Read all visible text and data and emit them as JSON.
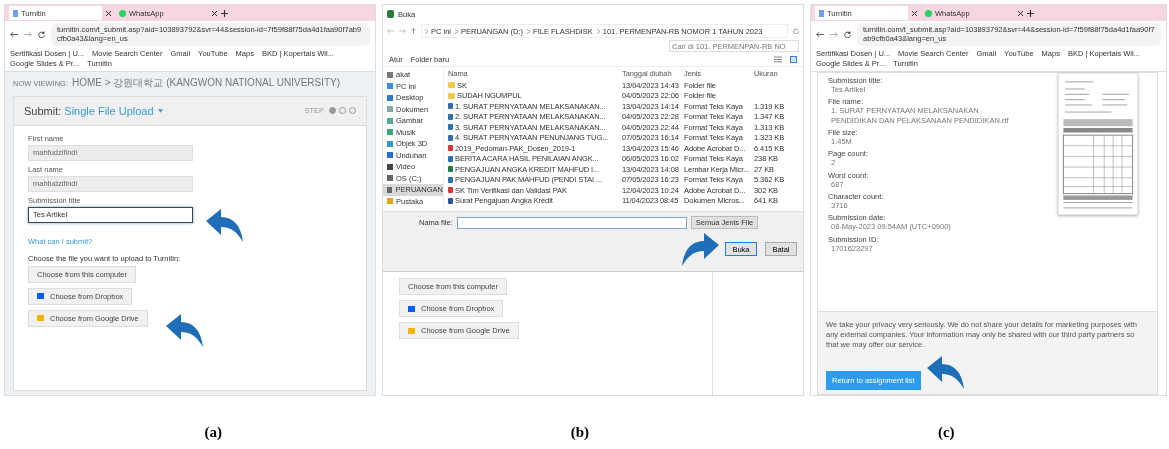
{
  "panel_a": {
    "browser": {
      "tabs": [
        {
          "label": "Turnitin",
          "selected": true
        },
        {
          "label": "WhatsApp",
          "selected": false
        }
      ],
      "url": "turnitin.com/t_submit.asp?aid=103893792&svr=44&session-id=7f59f88f75da4d1faa90f7ab9cfb0a43&lang=en_us",
      "bookmarks": [
        "Sertifikasi Dosen | U...",
        "Movie Search Center",
        "Gmail",
        "YouTube",
        "Maps",
        "BKD | Kopertais Wil...",
        "Google Slides & Pr...",
        "Turnitin"
      ]
    },
    "now_viewing_label": "NOW VIEWING:",
    "breadcrumb": "HOME > 강원대학교 (KANGWON NATIONAL UNIVERSITY)",
    "submit_label": "Submit:",
    "upload_mode": "Single File Upload",
    "step_label": "STEP",
    "steps": [
      {
        "selected": true
      },
      {
        "selected": false
      },
      {
        "selected": false
      }
    ],
    "fields": [
      {
        "label": "First name",
        "value": "mahfudzifindi",
        "disabled": true
      },
      {
        "label": "Last name",
        "value": "mahfudzifindi",
        "disabled": true
      },
      {
        "label": "Submission title",
        "value": "Tes Artikel",
        "disabled": false
      }
    ],
    "help_link": "What can I submit?",
    "choose_prompt": "Choose the file you want to upload to Turnitin:",
    "upload_buttons": [
      {
        "kind": "computer",
        "label": "Choose from this computer"
      },
      {
        "kind": "dropbox",
        "label": "Choose from Dropbox"
      },
      {
        "kind": "drive",
        "label": "Choose from Google Drive"
      }
    ]
  },
  "panel_b": {
    "title": "Buka",
    "path": [
      "PC ini",
      "PERUANGAN (D:)",
      "FILE FLASHDISK",
      "101. PERMENPAN-RB NOMOR 1 TAHUN 2023"
    ],
    "search_placeholder": "Cari di 101. PERMENPAN-RB NO",
    "toolbar": [
      "Atur",
      "Folder baru"
    ],
    "sidebar": [
      {
        "kind": "user",
        "label": "akat",
        "selected": false
      },
      {
        "kind": "pc",
        "label": "PC ini",
        "selected": false
      },
      {
        "kind": "desktop",
        "label": "Desktop",
        "selected": false
      },
      {
        "kind": "docs",
        "label": "Dokumen",
        "selected": false
      },
      {
        "kind": "pictures",
        "label": "Gambar",
        "selected": false
      },
      {
        "kind": "music",
        "label": "Musik",
        "selected": false
      },
      {
        "kind": "objects",
        "label": "Objek 3D",
        "selected": false
      },
      {
        "kind": "download",
        "label": "Unduhan",
        "selected": false
      },
      {
        "kind": "video",
        "label": "Video",
        "selected": false
      },
      {
        "kind": "drive",
        "label": "OS (C:)",
        "selected": false
      },
      {
        "kind": "drive",
        "label": "PERUANGAN",
        "selected": true
      },
      {
        "kind": "library",
        "label": "Pustaka",
        "selected": false
      }
    ],
    "columns": [
      "Nama",
      "Tanggal diubah",
      "Jenis",
      "Ukuran"
    ],
    "files": [
      {
        "kind": "folder",
        "name": "SK",
        "date": "13/04/2023 14:43",
        "type": "Folder file"
      },
      {
        "kind": "folder",
        "name": "SUDAH NGUMPUL",
        "date": "04/05/2023 22:06",
        "type": "Folder file"
      },
      {
        "kind": "rtf",
        "name": "1. SURAT PERNYATAAN MELAKSANAKAN...",
        "date": "13/04/2023 14:14",
        "type": "Format Teks Kaya",
        "size": "1.319 KB"
      },
      {
        "kind": "rtf",
        "name": "2. SURAT PERNYATAAN MELAKSANAKAN...",
        "date": "04/05/2023 22:28",
        "type": "Format Teks Kaya",
        "size": "1.347 KB"
      },
      {
        "kind": "rtf",
        "name": "3. SURAT PERNYATAAN MELAKSANAKAN...",
        "date": "04/05/2023 22:44",
        "type": "Format Teks Kaya",
        "size": "1.313 KB"
      },
      {
        "kind": "rtf",
        "name": "4. SURAT PERNYATAAN PENUNJANG TUG...",
        "date": "07/05/2023 16:14",
        "type": "Format Teks Kaya",
        "size": "1.323 KB"
      },
      {
        "kind": "pdf",
        "name": "2019_Pedoman-PAK_Dosen_2019-1",
        "date": "13/04/2023 15:46",
        "type": "Adobe Acrobat D...",
        "size": "6.415 KB"
      },
      {
        "kind": "rtf",
        "name": "BERITA ACARA HASIL PENILAIAN ANGK...",
        "date": "06/05/2023 16:02",
        "type": "Format Teks Kaya",
        "size": "238 KB"
      },
      {
        "kind": "excel",
        "name": "PENGAJUAN ANGKA KREDIT MAHFUD I...",
        "date": "13/04/2023 14:08",
        "type": "Lembar Kerja Micr...",
        "size": "27 KB"
      },
      {
        "kind": "rtf",
        "name": "PENGAJUAN PAK MAHFUD (PENDI STAI ...",
        "date": "07/05/2023 16:23",
        "type": "Format Teks Kaya",
        "size": "5.362 KB"
      },
      {
        "kind": "pdf",
        "name": "SK Tim Verifikasi dan Validasi PAK",
        "date": "12/04/2023 10:24",
        "type": "Adobe Acrobat D...",
        "size": "302 KB"
      },
      {
        "kind": "word",
        "name": "Surat Pengajuan Angka Kredit",
        "date": "11/04/2023 08:45",
        "type": "Dokumen Micros...",
        "size": "641 KB"
      }
    ],
    "filename_label": "Nama file:",
    "filter": "Semua Jenis File",
    "buttons": [
      {
        "kind": "primary",
        "label": "Buka"
      },
      {
        "kind": "secondary",
        "label": "Batal"
      }
    ],
    "upload_buttons": [
      {
        "kind": "computer",
        "label": "Choose from this computer"
      },
      {
        "kind": "dropbox",
        "label": "Choose from Dropbox"
      },
      {
        "kind": "drive",
        "label": "Choose from Google Drive"
      }
    ]
  },
  "panel_c": {
    "browser": {
      "tabs": [
        {
          "label": "Turnitin",
          "selected": true
        },
        {
          "label": "WhatsApp",
          "selected": false
        }
      ],
      "url": "turnitin.com/t_submit.asp?aid=103893792&svr=44&session-id=7f59f88f75da4d1faa90f7ab9cfb0a43&lang=en_us",
      "bookmarks": [
        "Sertifikasi Dosen | U...",
        "Movie Search Center",
        "Gmail",
        "YouTube",
        "Maps",
        "BKD | Kopertais Wil...",
        "Google Slides & Pr...",
        "Turnitin"
      ]
    },
    "details": [
      {
        "label": "Submission title:",
        "value": "Tes Artikel"
      },
      {
        "label": "File name:",
        "value": "1. SURAT PERNYATAAN MELAKSANAKAN PENDIDIKAN DAN PELAKSANAAN PENDIDIKAN.rtf"
      },
      {
        "label": "File size:",
        "value": "1.45M"
      },
      {
        "label": "Page count:",
        "value": "2"
      },
      {
        "label": "Word count:",
        "value": "687"
      },
      {
        "label": "Character count:",
        "value": "3716"
      },
      {
        "label": "Submission date:",
        "value": "08-May-2023 09:54AM (UTC+0900)"
      },
      {
        "label": "Submission ID:",
        "value": "1701623297"
      }
    ],
    "privacy_text": "We take your privacy very seriously. We do not share your details for marketing purposes with any external companies. Your information may only be shared with our third party partners so that we may offer our service.",
    "return_button": "Return to assignment list"
  },
  "captions": [
    "(a)",
    "(b)",
    "(c)"
  ]
}
